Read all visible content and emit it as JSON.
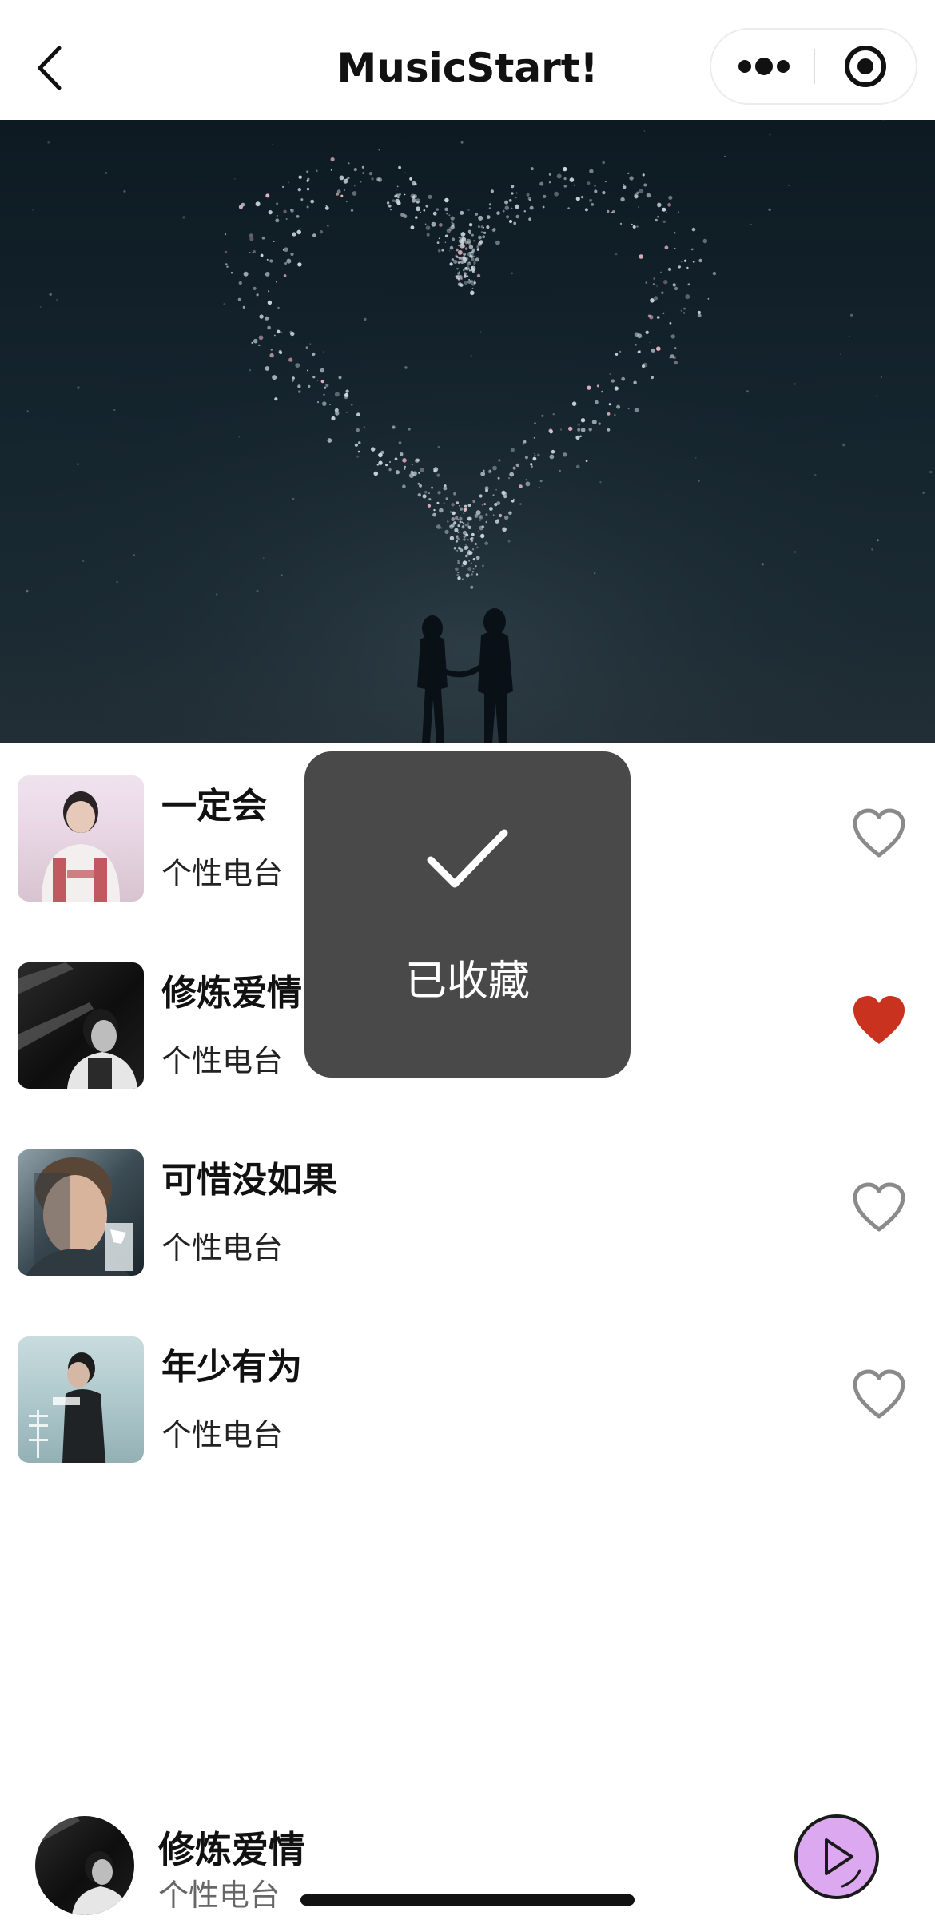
{
  "nav": {
    "title": "MusicStart!",
    "back_icon": "chevron-left-icon",
    "more_icon": "more-dots-icon",
    "close_icon": "target-close-icon"
  },
  "songs": [
    {
      "title": "一定会",
      "subtitle": "个性电台",
      "favorited": false
    },
    {
      "title": "修炼爱情",
      "subtitle": "个性电台",
      "favorited": true
    },
    {
      "title": "可惜没如果",
      "subtitle": "个性电台",
      "favorited": false
    },
    {
      "title": "年少有为",
      "subtitle": "个性电台",
      "favorited": false
    }
  ],
  "toast": {
    "text": "已收藏",
    "icon": "checkmark-icon"
  },
  "player": {
    "title": "修炼爱情",
    "subtitle": "个性电台",
    "play_icon": "play-icon"
  },
  "colors": {
    "favorite_active": "#c8321e",
    "favorite_inactive": "#8a8a8a",
    "play_button_fill": "#dca8f0",
    "toast_bg": "#3a3a3a"
  }
}
